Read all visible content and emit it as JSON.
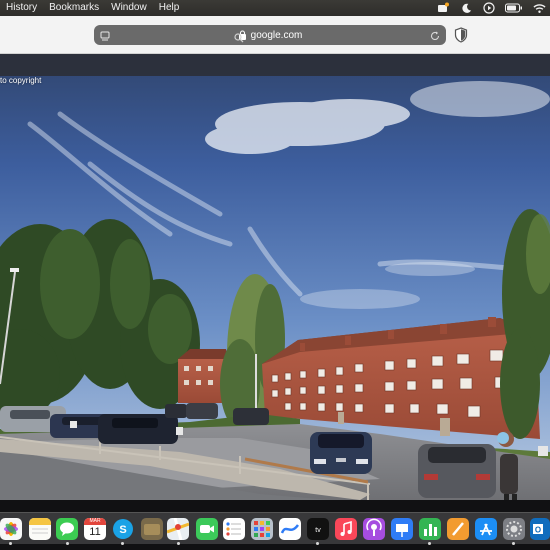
{
  "menubar": {
    "items": [
      "History",
      "Bookmarks",
      "Window",
      "Help"
    ],
    "status_icons": [
      "notification-icon",
      "moon-icon",
      "play-icon",
      "battery-icon",
      "wifi-icon"
    ]
  },
  "toolbar": {
    "url": "google.com",
    "icons": [
      "page-icon",
      "lock-icon",
      "reload-icon",
      "privacy-shield-icon"
    ]
  },
  "streetview": {
    "copyright_text": "to copyright"
  },
  "dock": {
    "calendar_month": "MAR",
    "calendar_day": "11",
    "apps": [
      "photos",
      "notes",
      "messages",
      "calendar",
      "skype",
      "finder-folder",
      "maps",
      "facetime",
      "reminders",
      "launchpad",
      "freeform",
      "apple-tv",
      "music",
      "podcasts",
      "keynote",
      "numbers",
      "pages",
      "app-store",
      "system-settings",
      "outlook"
    ]
  },
  "colors": {
    "menubar": "#2e2d2a",
    "toolbar": "#f3f3f3",
    "addressbar": "#6a6a6a",
    "sky": "#4f74b4",
    "brick": "#b1573f"
  }
}
